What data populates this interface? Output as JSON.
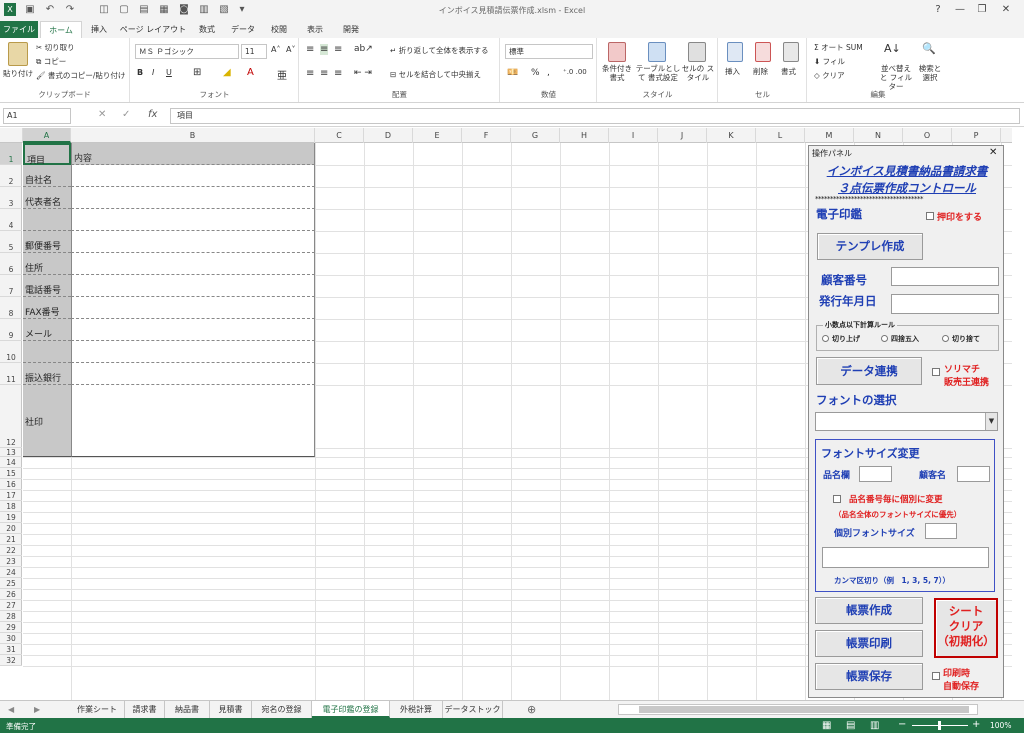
{
  "window": {
    "title": "インボイス見積請伝票作成.xlsm - Excel",
    "help": "?",
    "minimize": "—",
    "restore": "❐",
    "close": "✕"
  },
  "tabs": [
    "ファイル",
    "ホーム",
    "挿入",
    "ページ レイアウト",
    "数式",
    "データ",
    "校閲",
    "表示",
    "開発"
  ],
  "ribbon": {
    "clipboard": {
      "paste": "貼り付け",
      "cut": "切り取り",
      "copy": "コピー",
      "format_painter": "書式のコピー/貼り付け",
      "label": "クリップボード"
    },
    "font": {
      "name": "ＭＳ Ｐゴシック",
      "size": "11",
      "bold": "B",
      "italic": "I",
      "underline": "U",
      "label": "フォント"
    },
    "alignment": {
      "wrap": "折り返して全体を表示する",
      "merge": "セルを結合して中央揃え",
      "label": "配置"
    },
    "number": {
      "format": "標準",
      "percent": "%",
      "comma": ",",
      "label": "数値"
    },
    "styles": {
      "conditional": "条件付き 書式",
      "table": "テーブルとして 書式設定",
      "cell": "セルの スタイル",
      "label": "スタイル"
    },
    "cells": {
      "insert": "挿入",
      "delete": "削除",
      "format": "書式",
      "label": "セル"
    },
    "editing": {
      "autosum": "オート SUM",
      "fill": "フィル",
      "clear": "クリア",
      "sort": "並べ替えと フィルター",
      "find": "検索と 選択",
      "label": "編集"
    }
  },
  "formula_bar": {
    "name_box": "A1",
    "value": "項目",
    "fx": "fx"
  },
  "columns": [
    "A",
    "B",
    "C",
    "D",
    "E",
    "F",
    "G",
    "H",
    "I",
    "J",
    "K",
    "L",
    "M",
    "N",
    "O",
    "P"
  ],
  "rows": [
    "1",
    "2",
    "3",
    "4",
    "5",
    "6",
    "7",
    "8",
    "9",
    "10",
    "11",
    "12",
    "13",
    "14",
    "15",
    "16",
    "17",
    "18",
    "19",
    "20",
    "21",
    "22",
    "23",
    "24",
    "25",
    "26",
    "27",
    "28",
    "29",
    "30",
    "31",
    "32"
  ],
  "table": {
    "header_a": "項目",
    "header_b": "内容",
    "labels": [
      "自社名",
      "代表者名",
      "",
      "郵便番号",
      "住所",
      "電話番号",
      "FAX番号",
      "メール",
      "",
      "振込銀行",
      "社印"
    ]
  },
  "panel": {
    "title": "操作パネル",
    "close": "✕",
    "heading1": "インボイス見積書納品書請求書",
    "heading2": "３点伝票作成コントロール",
    "stars": "************************************",
    "seal": "電子印鑑",
    "seal_check": "押印をする",
    "template_button": "テンプレ作成",
    "customer_no": "顧客番号",
    "issue_date": "発行年月日",
    "rounding_group": "小数点以下計算ルール",
    "round_up": "切り上げ",
    "round_half": "四捨五入",
    "round_down": "切り捨て",
    "data_link": "データ連携",
    "solimachi1": "ソリマチ",
    "solimachi2": "販売王連携",
    "font_select": "フォントの選択",
    "font_size_title": "フォントサイズ変更",
    "item_col": "品名欄",
    "customer_name": "顧客名",
    "individual_check": "品名番号毎に個別に変更",
    "priority_note": "（品名全体のフォントサイズに優先）",
    "individual_size": "個別フォントサイズ",
    "comma_note": "カンマ区切り（例　1, 3, 5, 7））",
    "create": "帳票作成",
    "print": "帳票印刷",
    "save": "帳票保存",
    "clear1": "シート",
    "clear2": "クリア",
    "clear3": "（初期化）",
    "auto_save1": "印刷時",
    "auto_save2": "自動保存"
  },
  "sheet_tabs": [
    "作業シート",
    "請求書",
    "納品書",
    "見積書",
    "宛名の登録",
    "電子印鑑の登録",
    "外税計算",
    "データストック"
  ],
  "sheet_add": "⊕",
  "status": {
    "ready": "準備完了",
    "zoom": "100%",
    "minus": "−",
    "plus": "+"
  }
}
